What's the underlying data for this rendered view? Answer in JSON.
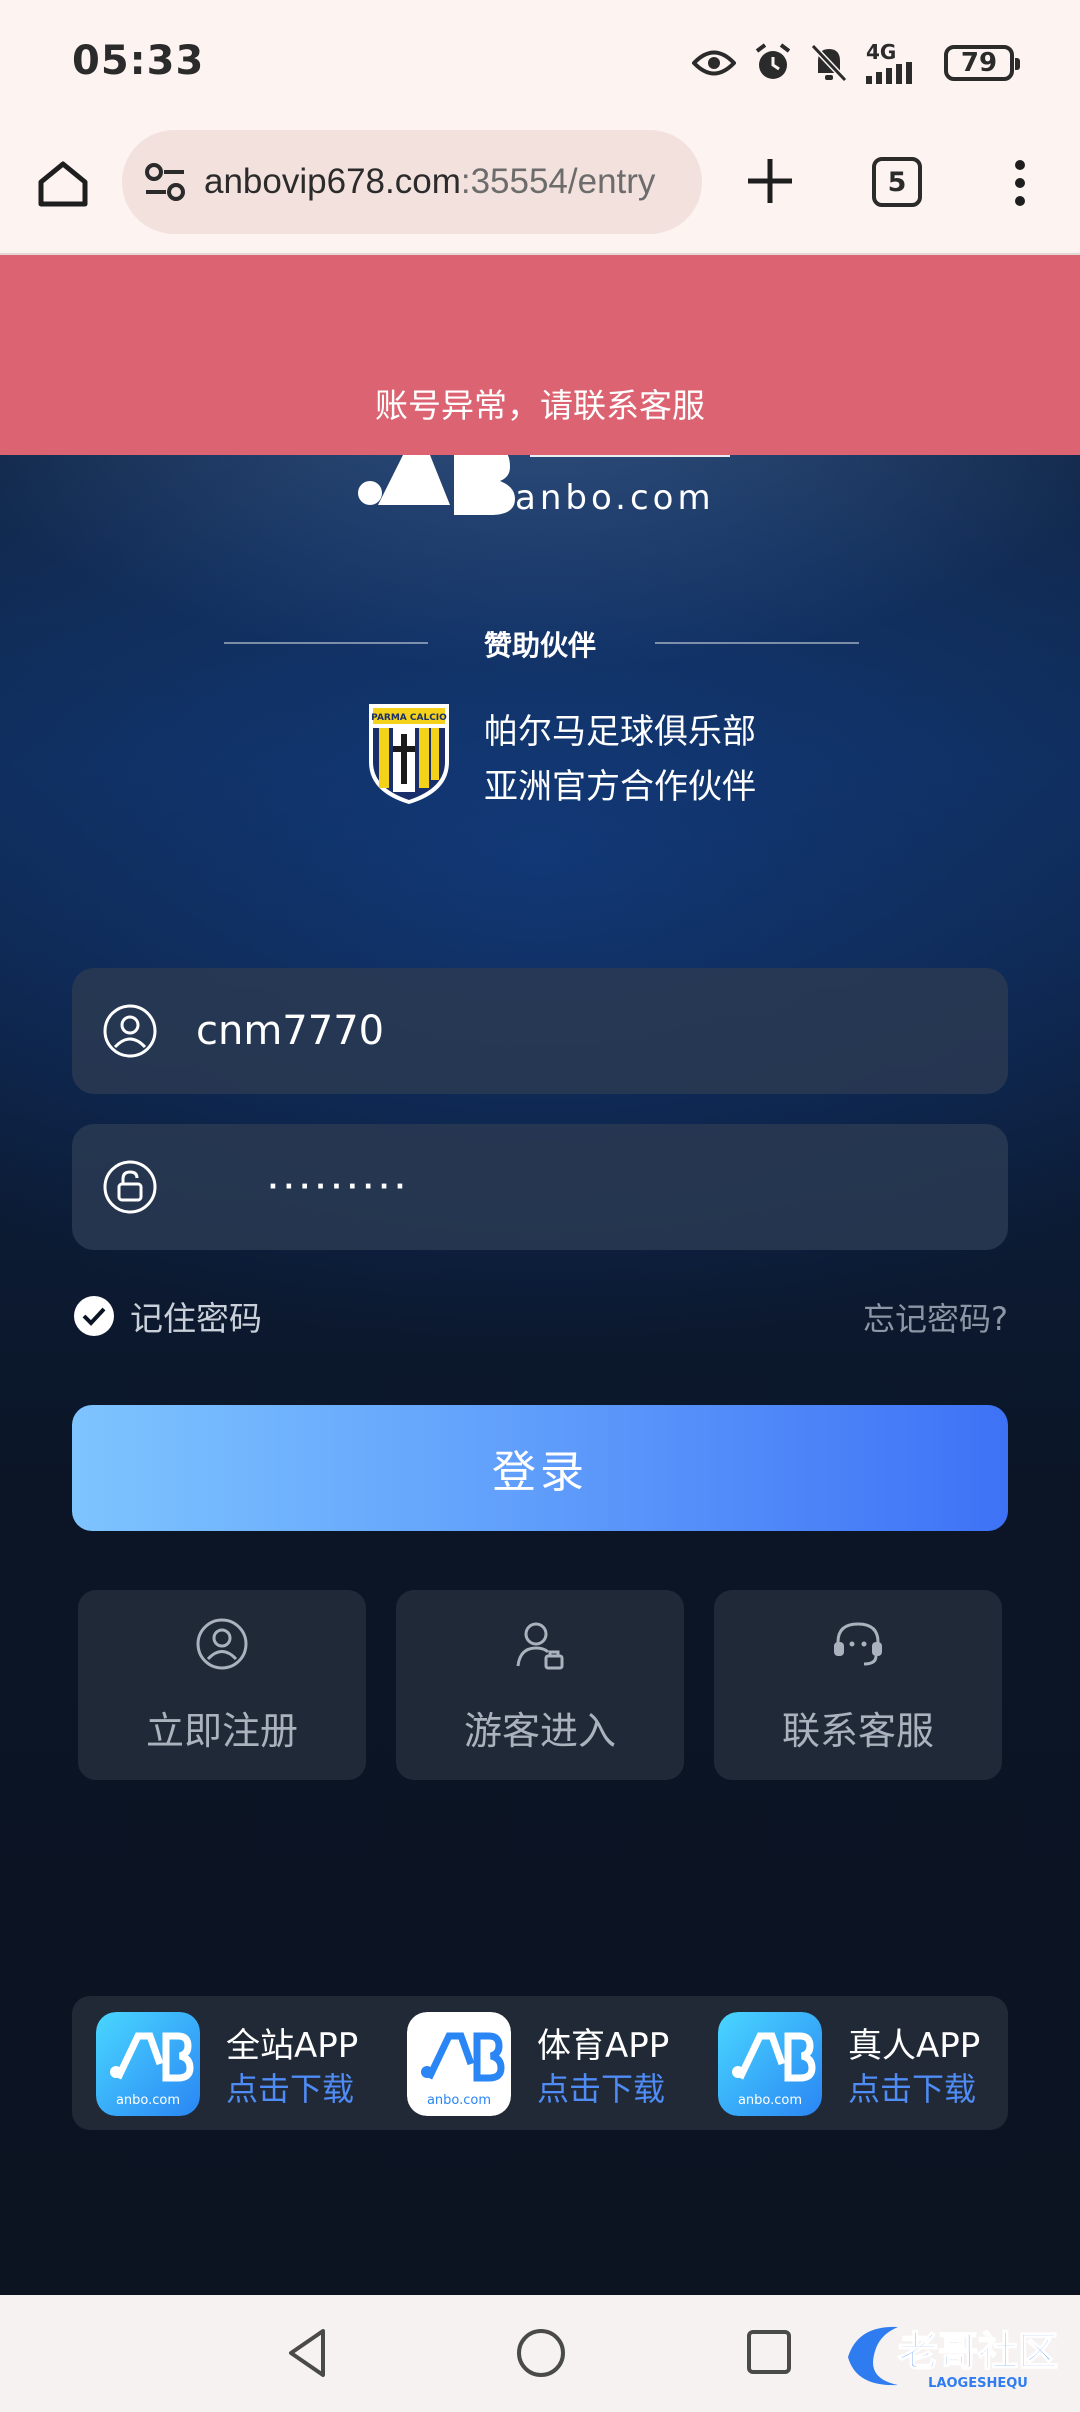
{
  "status_bar": {
    "time": "05:33",
    "network": "4G",
    "battery": "79",
    "icons": [
      "eye-icon",
      "alarm-icon",
      "bell-off-icon",
      "signal-icon",
      "battery-icon"
    ]
  },
  "browser": {
    "url_host": "anbovip678.com",
    "url_rest": ":35554/entry",
    "tab_count": "5",
    "icons": [
      "home-icon",
      "site-settings-icon",
      "new-tab-icon",
      "menu-icon"
    ]
  },
  "alert": {
    "message": "账号异常，请联系客服",
    "color": "#dc6472"
  },
  "brand": {
    "domain": "anbo.com"
  },
  "sponsor": {
    "label": "赞助伙伴",
    "crest_text": "PARMA CALCIO",
    "partner_line1": "帕尔马足球俱乐部",
    "partner_line2": "亚洲官方合作伙伴"
  },
  "login_form": {
    "username": "cnm7770",
    "password_mask": "·········",
    "remember_label": "记住密码",
    "remember_checked": true,
    "forgot_label": "忘记密码?",
    "login_label": "登录"
  },
  "quick_actions": [
    {
      "label": "立即注册",
      "icon": "user-circle-icon"
    },
    {
      "label": "游客进入",
      "icon": "guest-icon"
    },
    {
      "label": "联系客服",
      "icon": "headset-icon"
    }
  ],
  "apps": [
    {
      "name": "全站APP",
      "action": "点击下载",
      "icon_text": "anbo.com"
    },
    {
      "name": "体育APP",
      "action": "点击下载",
      "icon_text": "anbo.com"
    },
    {
      "name": "真人APP",
      "action": "点击下载",
      "icon_text": "anbo.com"
    }
  ],
  "nav": {
    "watermark": "老哥社区",
    "watermark_sub": "LAOGESHEQU"
  },
  "colors": {
    "login_gradient_start": "#7ec4ff",
    "login_gradient_end": "#3e72f6",
    "download_link": "#4f8cf6"
  }
}
